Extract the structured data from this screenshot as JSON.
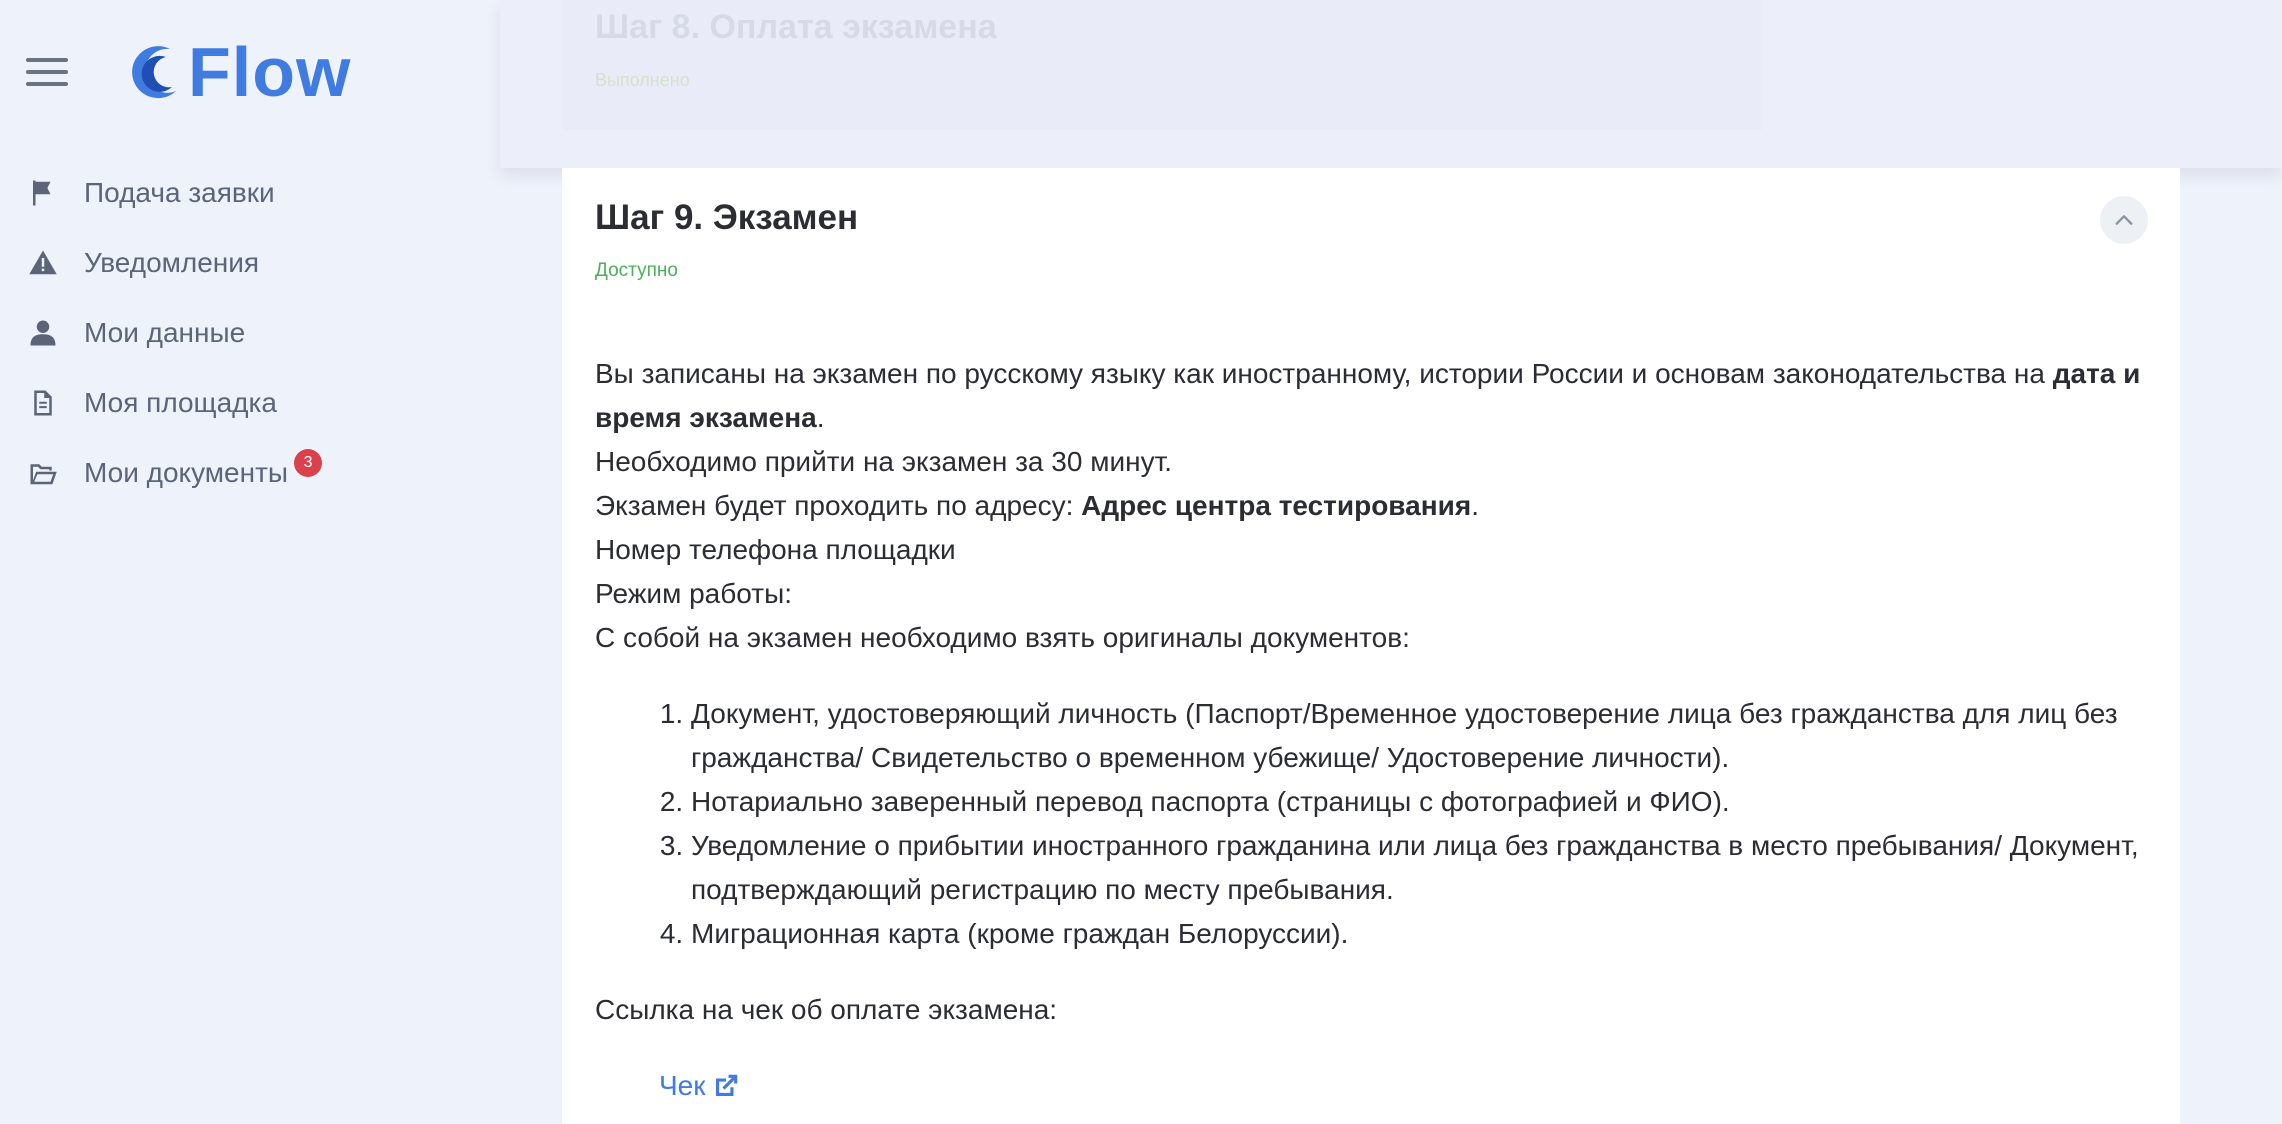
{
  "app": {
    "logo_text": "Flow",
    "accent_color": "#3f7be0"
  },
  "sidebar": {
    "items": [
      {
        "label": "Подача заявки",
        "icon": "flag-icon"
      },
      {
        "label": "Уведомления",
        "icon": "warning-icon"
      },
      {
        "label": "Мои данные",
        "icon": "user-icon"
      },
      {
        "label": "Моя площадка",
        "icon": "document-icon"
      },
      {
        "label": "Мои документы",
        "icon": "folder-open-icon",
        "badge": "3"
      }
    ]
  },
  "previous_step": {
    "title": "Шаг 8. Оплата экзамена",
    "status": "Выполнено"
  },
  "step": {
    "title": "Шаг 9. Экзамен",
    "status": "Доступно",
    "status_color": "#4caf5a",
    "intro_text": "Вы записаны на экзамен по русскому языку как иностранному, истории России и основам законодательства на",
    "exam_datetime": "дата и время экзамена",
    "arrive_text": "Необходимо прийти на экзамен за 30 минут.",
    "address_prefix": "Экзамен будет проходить по адресу: ",
    "address": "Адрес центра тестирования",
    "phone_label": "Номер телефона площадки",
    "hours_label": "Режим работы:",
    "documents_intro": "С собой на экзамен необходимо взять оригиналы документов:",
    "documents": [
      "Документ, удостоверяющий личность (Паспорт/Временное удостоверение лица без гражданства для лиц без гражданства/ Свидетельство о временном убежище/ Удостоверение личности).",
      "Нотариально заверенный перевод паспорта (страницы с фотографией и ФИО).",
      "Уведомление о прибытии иностранного гражданина или лица без гражданства в место пребывания/ Документ, подтверждающий регистрацию по месту пребывания.",
      "Миграционная карта (кроме граждан Белоруссии)."
    ],
    "receipt_intro": "Ссылка на чек об оплате экзамена:",
    "receipt_link_label": "Чек"
  }
}
